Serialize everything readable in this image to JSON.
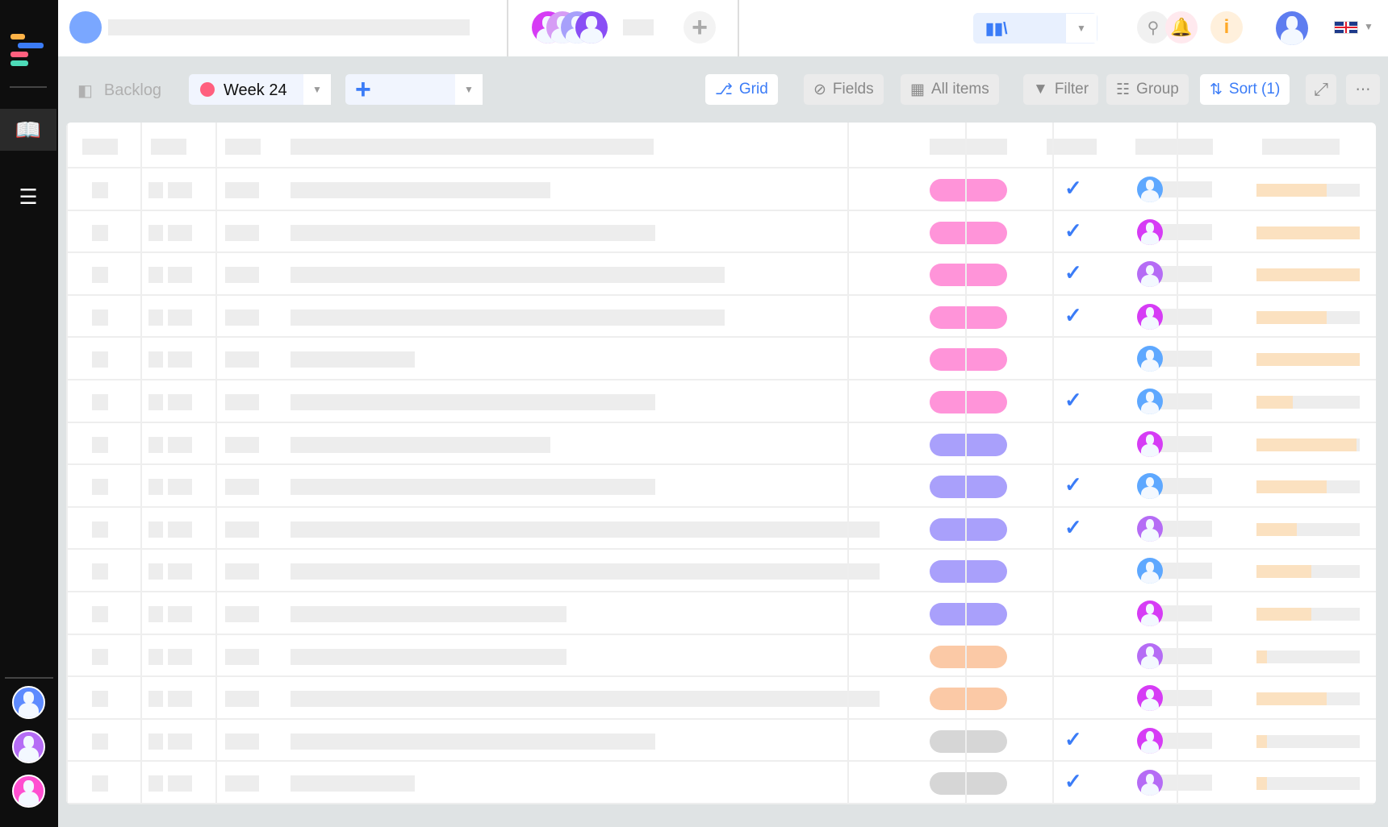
{
  "toolbar": {
    "backlog": "Backlog",
    "sprint": "Week 24",
    "grid": "Grid",
    "fields": "Fields",
    "all_items": "All items",
    "filter": "Filter",
    "group": "Group",
    "sort": "Sort (1)"
  },
  "colors": {
    "accent": "#3b7cf7",
    "sprint_dot": "#ff5f7e",
    "tag_pink": "#ff94d9",
    "tag_violet": "#a9a0fb",
    "tag_peach": "#fbc9a6",
    "tag_gray": "#d6d6d6",
    "progress_fill": "#fbe1c0",
    "progress_track": "#ededed",
    "avatar_blue": "#5ea8ff",
    "avatar_magenta": "#d63cf5",
    "avatar_purple": "#b56cf5"
  },
  "icons": [
    "logo-icon",
    "book-icon",
    "list-icon",
    "search-icon",
    "bell-icon",
    "info-icon",
    "flag-uk-icon",
    "plus-icon",
    "grid-icon",
    "eye-off-icon",
    "grid-squares-icon",
    "filter-icon",
    "group-icon",
    "sort-icon",
    "expand-icon",
    "more-icon"
  ],
  "rows": [
    {
      "tag": "pink",
      "checked": true,
      "avatar": "blue",
      "progress": 0.68
    },
    {
      "tag": "pink",
      "checked": true,
      "avatar": "magenta",
      "progress": 1.0
    },
    {
      "tag": "pink",
      "checked": true,
      "avatar": "purple",
      "progress": 1.0
    },
    {
      "tag": "pink",
      "checked": true,
      "avatar": "magenta",
      "progress": 0.68
    },
    {
      "tag": "pink",
      "checked": false,
      "avatar": "blue",
      "progress": 1.0
    },
    {
      "tag": "pink",
      "checked": true,
      "avatar": "blue",
      "progress": 0.35
    },
    {
      "tag": "violet",
      "checked": false,
      "avatar": "magenta",
      "progress": 0.97
    },
    {
      "tag": "violet",
      "checked": true,
      "avatar": "blue",
      "progress": 0.68
    },
    {
      "tag": "violet",
      "checked": true,
      "avatar": "purple",
      "progress": 0.39
    },
    {
      "tag": "violet",
      "checked": false,
      "avatar": "blue",
      "progress": 0.53
    },
    {
      "tag": "violet",
      "checked": false,
      "avatar": "magenta",
      "progress": 0.53
    },
    {
      "tag": "peach",
      "checked": false,
      "avatar": "purple",
      "progress": 0.1
    },
    {
      "tag": "peach",
      "checked": false,
      "avatar": "magenta",
      "progress": 0.68
    },
    {
      "tag": "gray",
      "checked": true,
      "avatar": "magenta",
      "progress": 0.1
    },
    {
      "tag": "gray",
      "checked": true,
      "avatar": "purple",
      "progress": 0.1
    }
  ]
}
